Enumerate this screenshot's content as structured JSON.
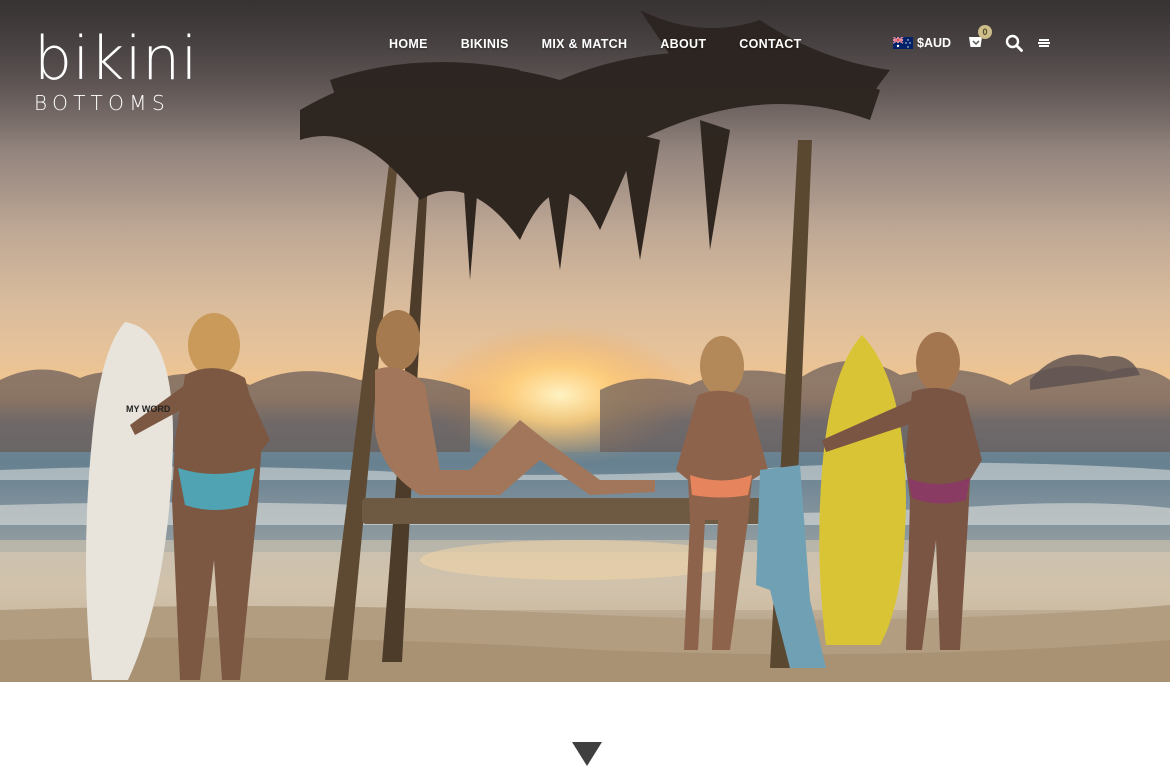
{
  "logo": {
    "main": "bikini",
    "sub": "BOTTOMS"
  },
  "nav": {
    "items": [
      {
        "label": "HOME"
      },
      {
        "label": "BIKINIS"
      },
      {
        "label": "MIX & MATCH"
      },
      {
        "label": "ABOUT"
      },
      {
        "label": "CONTACT"
      }
    ]
  },
  "utils": {
    "currency": "$AUD",
    "cart_count": "0",
    "icons": [
      "australia-flag-icon",
      "cart-icon",
      "search-icon",
      "menu-icon"
    ]
  },
  "hero": {
    "image": "beach-sunset-photo",
    "surfboard_text": "MY WORD"
  },
  "scroll_icon": "chevron-down-icon"
}
